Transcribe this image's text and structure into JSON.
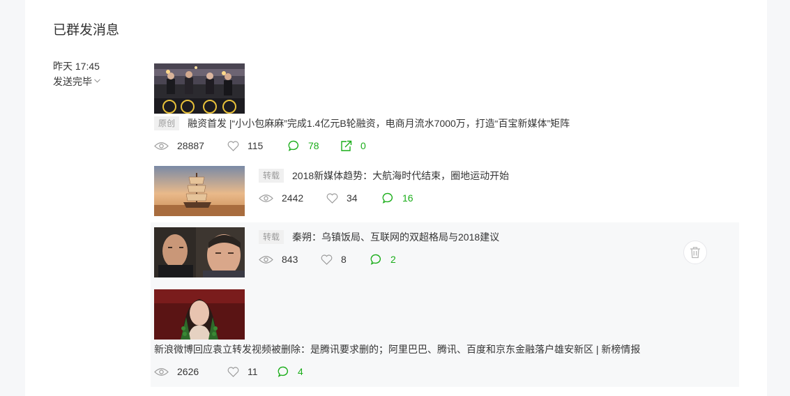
{
  "page": {
    "title": "已群发消息"
  },
  "batch": {
    "time": "昨天 17:45",
    "status": "发送完毕"
  },
  "articles": [
    {
      "tag": "原创",
      "title": "融资首发 |“小小包麻麻”完成1.4亿元B轮融资，电商月流水7000万，打造“百宝新媒体”矩阵",
      "reads": "28887",
      "likes": "115",
      "comments": "78",
      "shares": "0"
    },
    {
      "tag": "转载",
      "title": "2018新媒体趋势：大航海时代结束，圈地运动开始",
      "reads": "2442",
      "likes": "34",
      "comments": "16"
    },
    {
      "tag": "转载",
      "title": "秦朔：乌镇饭局、互联网的双超格局与2018建议",
      "reads": "843",
      "likes": "8",
      "comments": "2"
    },
    {
      "title": "新浪微博回应袁立转发视频被删除：是腾讯要求删的；阿里巴巴、腾讯、百度和京东金融落户雄安新区 | 新榜情报",
      "reads": "2626",
      "likes": "11",
      "comments": "4"
    }
  ],
  "icons": {
    "read": "eye-icon",
    "like": "heart-icon",
    "comment": "comment-icon",
    "share": "share-icon",
    "delete": "trash-icon"
  },
  "colors": {
    "accent": "#1aad19",
    "tag_bg": "#f0f0f0",
    "hover_bg": "#f7f8f9"
  }
}
